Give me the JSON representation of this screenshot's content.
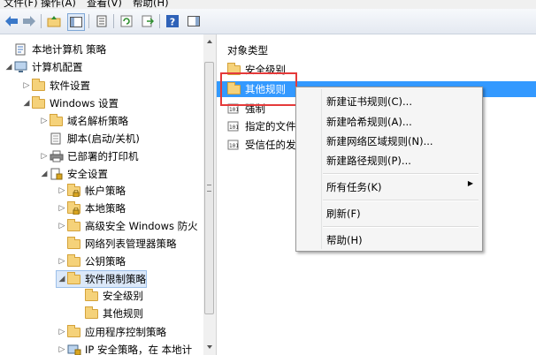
{
  "menubar": {
    "items": [
      "文件(F)",
      "操作(A)",
      "查看(V)",
      "帮助(H)"
    ]
  },
  "toolbar": {
    "buttons": [
      "back-icon",
      "forward-icon",
      "up-folder-icon",
      "console-tree-icon",
      "properties-icon",
      "refresh-icon",
      "export-icon",
      "help-icon",
      "action-pane-icon"
    ]
  },
  "tree": {
    "items": [
      {
        "label": "本地计算机 策略",
        "expander": "",
        "icon": "policy-icon"
      },
      {
        "label": "计算机配置",
        "expander": "◢",
        "icon": "computer-icon"
      },
      {
        "label": "软件设置",
        "expander": "▷",
        "icon": "folder-icon"
      },
      {
        "label": "Windows 设置",
        "expander": "◢",
        "icon": "folder-icon"
      },
      {
        "label": "域名解析策略",
        "expander": "▷",
        "icon": "folder-icon"
      },
      {
        "label": "脚本(启动/关机)",
        "expander": "",
        "icon": "script-icon"
      },
      {
        "label": "已部署的打印机",
        "expander": "▷",
        "icon": "printer-icon"
      },
      {
        "label": "安全设置",
        "expander": "◢",
        "icon": "security-icon"
      },
      {
        "label": "帐户策略",
        "expander": "▷",
        "icon": "lock-folder-icon"
      },
      {
        "label": "本地策略",
        "expander": "▷",
        "icon": "lock-folder-icon"
      },
      {
        "label": "高级安全 Windows 防火",
        "expander": "▷",
        "icon": "folder-icon"
      },
      {
        "label": "网络列表管理器策略",
        "expander": "",
        "icon": "folder-icon"
      },
      {
        "label": "公钥策略",
        "expander": "▷",
        "icon": "folder-icon"
      },
      {
        "label": "软件限制策略",
        "expander": "◢",
        "icon": "folder-icon"
      },
      {
        "label": "安全级别",
        "expander": "",
        "icon": "folder-icon"
      },
      {
        "label": "其他规则",
        "expander": "",
        "icon": "folder-icon"
      },
      {
        "label": "应用程序控制策略",
        "expander": "▷",
        "icon": "folder-icon"
      },
      {
        "label": "IP 安全策略，在 本地计",
        "expander": "▷",
        "icon": "ip-security-icon"
      }
    ]
  },
  "rightpane": {
    "column_header": "对象类型",
    "items": [
      {
        "label": "安全级别",
        "icon": "folder-icon"
      },
      {
        "label": "其他规则",
        "icon": "folder-icon"
      },
      {
        "label": "强制",
        "icon": "enforcement-icon"
      },
      {
        "label": "指定的文件",
        "icon": "file-types-icon"
      },
      {
        "label": "受信任的发",
        "icon": "trusted-publishers-icon"
      }
    ]
  },
  "context_menu": {
    "items": [
      {
        "label": "新建证书规则(C)..."
      },
      {
        "label": "新建哈希规则(A)..."
      },
      {
        "label": "新建网络区域规则(N)..."
      },
      {
        "label": "新建路径规则(P)..."
      },
      {
        "label": "所有任务(K)",
        "submenu": true
      },
      {
        "label": "刷新(F)"
      },
      {
        "label": "帮助(H)"
      }
    ]
  },
  "colors": {
    "highlight_blue": "#3399ff",
    "annotation_red": "#e53a3a",
    "folder_yellow": "#f5d27a"
  }
}
